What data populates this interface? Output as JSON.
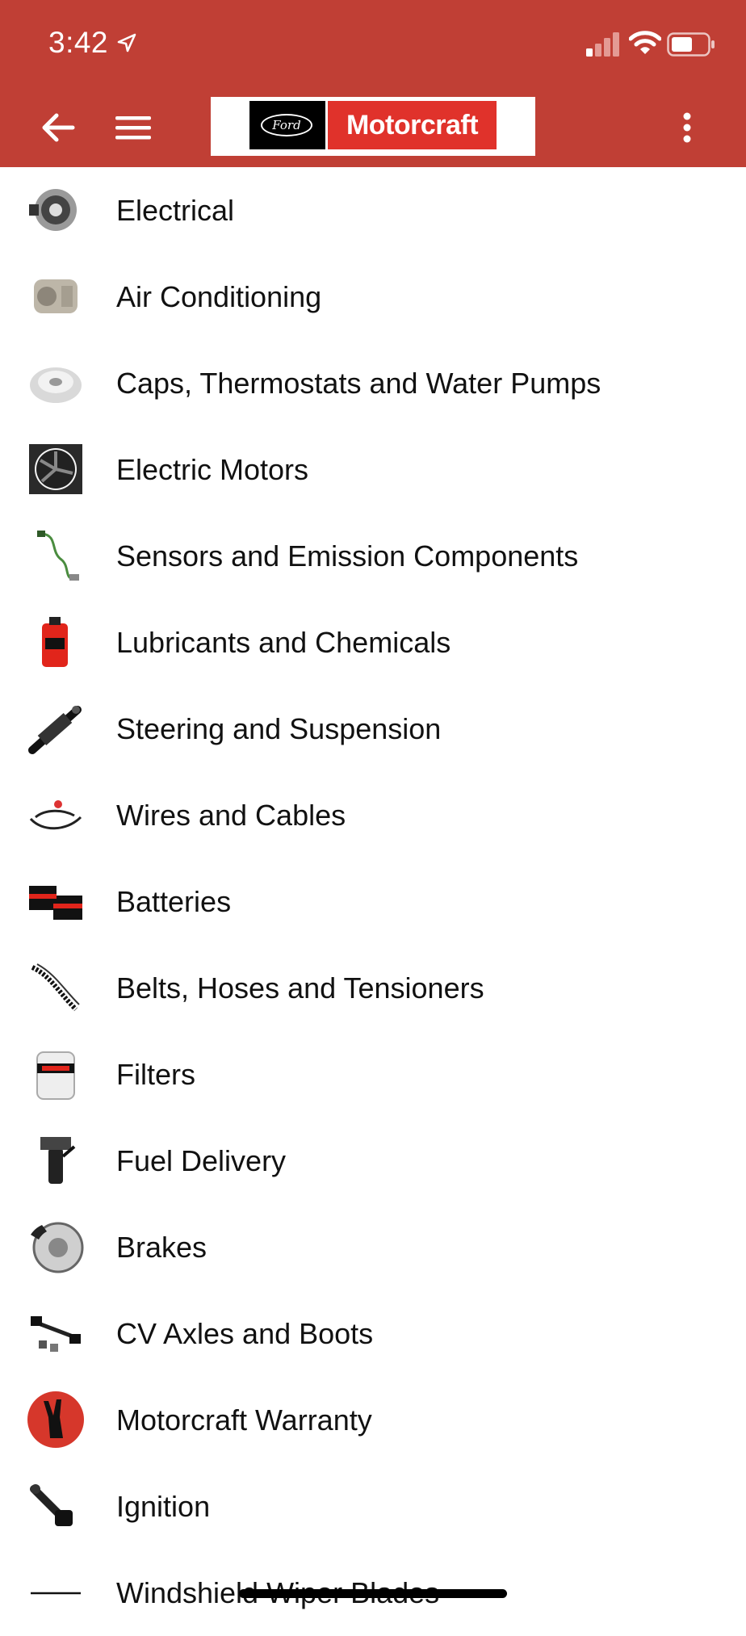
{
  "status_bar": {
    "time": "3:42",
    "icons": [
      "location-arrow-icon",
      "signal-icon",
      "wifi-icon",
      "battery-icon"
    ]
  },
  "toolbar": {
    "logo": {
      "ford": "Ford",
      "brand": "Motorcraft"
    },
    "icons": [
      "back-arrow-icon",
      "hamburger-menu-icon",
      "more-vertical-icon"
    ]
  },
  "colors": {
    "appbar": "#c03f35",
    "brand_red": "#e0322b"
  },
  "categories": [
    {
      "label": "Electrical",
      "icon": "alternator-icon"
    },
    {
      "label": "Air Conditioning",
      "icon": "ac-compressor-icon"
    },
    {
      "label": "Caps, Thermostats and Water Pumps",
      "icon": "radiator-cap-icon"
    },
    {
      "label": "Electric Motors",
      "icon": "cooling-fan-icon"
    },
    {
      "label": "Sensors and Emission Components",
      "icon": "oxygen-sensor-icon"
    },
    {
      "label": "Lubricants and Chemicals",
      "icon": "oil-bottle-icon"
    },
    {
      "label": "Steering and Suspension",
      "icon": "strut-icon"
    },
    {
      "label": "Wires and Cables",
      "icon": "wire-harness-icon"
    },
    {
      "label": "Batteries",
      "icon": "battery-pack-icon"
    },
    {
      "label": "Belts, Hoses and Tensioners",
      "icon": "serpentine-belt-icon"
    },
    {
      "label": "Filters",
      "icon": "oil-filter-icon"
    },
    {
      "label": "Fuel Delivery",
      "icon": "fuel-pump-icon"
    },
    {
      "label": "Brakes",
      "icon": "brake-rotor-icon"
    },
    {
      "label": "CV Axles and Boots",
      "icon": "cv-axle-icon"
    },
    {
      "label": "Motorcraft Warranty",
      "icon": "warranty-badge-icon"
    },
    {
      "label": "Ignition",
      "icon": "ignition-coil-icon"
    },
    {
      "label": "Windshield Wiper Blades",
      "icon": "wiper-blade-icon"
    }
  ]
}
